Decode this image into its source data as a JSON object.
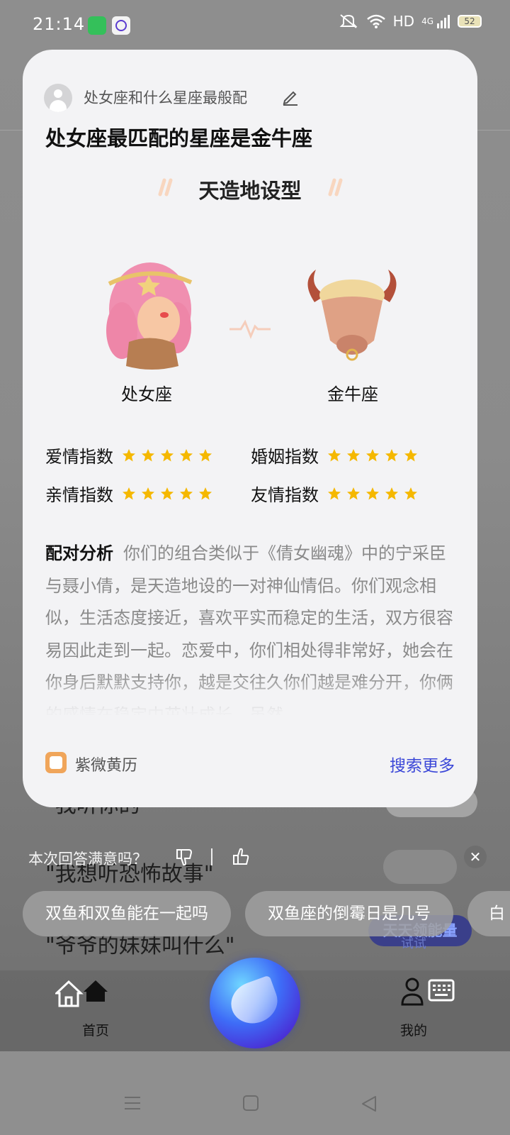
{
  "status_bar": {
    "time": "21:14",
    "network": "HD",
    "signal": "4G",
    "battery": "52"
  },
  "background": {
    "line1": "\"我听你的\"",
    "line2": "\"我想听恐怖故事\"",
    "line3": "\"爷爷的妹妹叫什么\"",
    "badge": "天天领能量",
    "badge_sub": "试试"
  },
  "card": {
    "question": "处女座和什么星座最般配",
    "answer_title": "处女座最匹配的星座是金牛座",
    "match_type": "天造地设型",
    "sign_left": "处女座",
    "sign_right": "金牛座",
    "indices": [
      {
        "label": "爱情指数",
        "stars": 5
      },
      {
        "label": "婚姻指数",
        "stars": 5
      },
      {
        "label": "亲情指数",
        "stars": 5
      },
      {
        "label": "友情指数",
        "stars": 5
      }
    ],
    "analysis_label": "配对分析",
    "analysis_text": "你们的组合类似于《倩女幽魂》中的宁采臣与聂小倩，是天造地设的一对神仙情侣。你们观念相似，生活态度接近，喜欢平实而稳定的生活，双方很容易因此走到一起。恋爱中，你们相处得非常好，她会在你身后默默支持你，越是交往久你们越是难分开，你俩的感情在稳定中茁壮成长，虽然",
    "source": "紫微黄历",
    "more": "搜索更多"
  },
  "feedback": {
    "prompt": "本次回答满意吗？"
  },
  "chips": [
    "双鱼和双鱼能在一起吗",
    "双鱼座的倒霉日是几号",
    "白"
  ],
  "nav": {
    "home": "首页",
    "me": "我的"
  },
  "colors": {
    "accent": "#3b47d8",
    "star": "#f5b800",
    "card_bg": "#f3f3f5"
  }
}
